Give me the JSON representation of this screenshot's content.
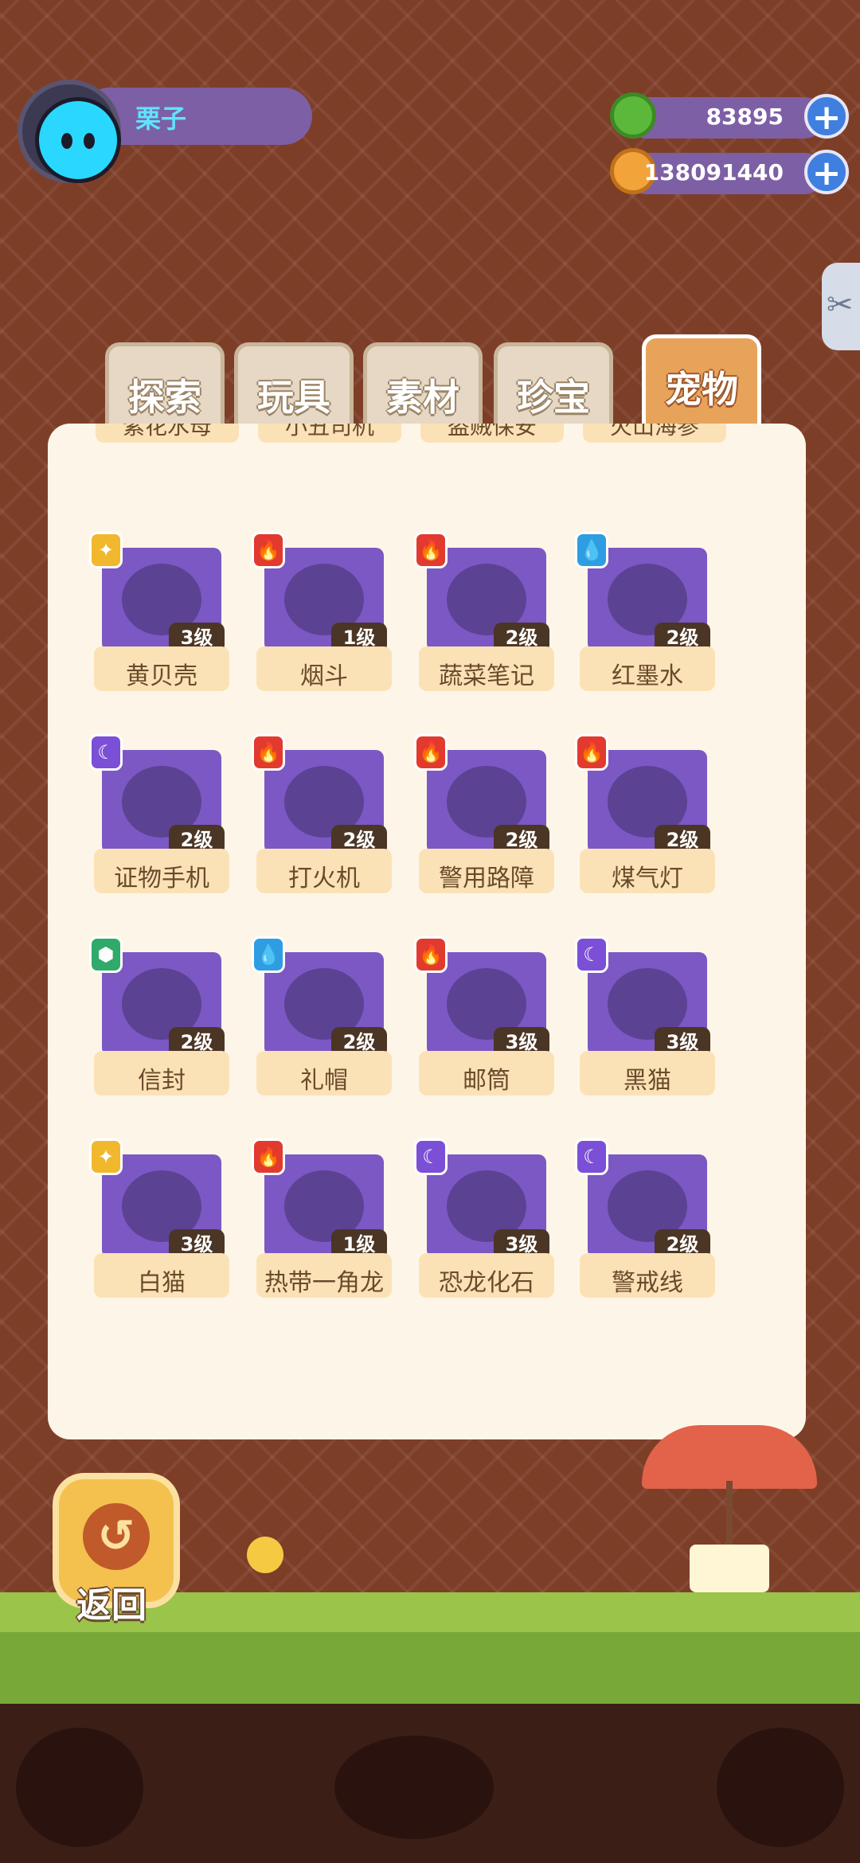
{
  "profile": {
    "name": "栗子"
  },
  "currencies": [
    {
      "icon": "donut-coin-icon",
      "value": "83895",
      "color": "#5bb83a"
    },
    {
      "icon": "planet-coin-icon",
      "value": "138091440",
      "color": "#f2a33a"
    }
  ],
  "tabs": [
    {
      "label": "探索",
      "active": false
    },
    {
      "label": "玩具",
      "active": false
    },
    {
      "label": "素材",
      "active": false
    },
    {
      "label": "珍宝",
      "active": false
    },
    {
      "label": "宠物",
      "active": true
    }
  ],
  "cut_row": [
    "紫花水母",
    "小丑司机",
    "盗贼保安",
    "火山海参"
  ],
  "items": [
    {
      "name": "黄贝壳",
      "level": "3级",
      "element": "star"
    },
    {
      "name": "烟斗",
      "level": "1级",
      "element": "fire"
    },
    {
      "name": "蔬菜笔记",
      "level": "2级",
      "element": "fire"
    },
    {
      "name": "红墨水",
      "level": "2级",
      "element": "water"
    },
    {
      "name": "证物手机",
      "level": "2级",
      "element": "moon"
    },
    {
      "name": "打火机",
      "level": "2级",
      "element": "fire"
    },
    {
      "name": "警用路障",
      "level": "2级",
      "element": "fire"
    },
    {
      "name": "煤气灯",
      "level": "2级",
      "element": "fire"
    },
    {
      "name": "信封",
      "level": "2级",
      "element": "leaf"
    },
    {
      "name": "礼帽",
      "level": "2级",
      "element": "water"
    },
    {
      "name": "邮筒",
      "level": "3级",
      "element": "fire"
    },
    {
      "name": "黑猫",
      "level": "3级",
      "element": "moon"
    },
    {
      "name": "白猫",
      "level": "3级",
      "element": "star"
    },
    {
      "name": "热带一角龙",
      "level": "1级",
      "element": "fire"
    },
    {
      "name": "恐龙化石",
      "level": "3级",
      "element": "moon"
    },
    {
      "name": "警戒线",
      "level": "2级",
      "element": "moon"
    }
  ],
  "back": {
    "label": "返回"
  }
}
